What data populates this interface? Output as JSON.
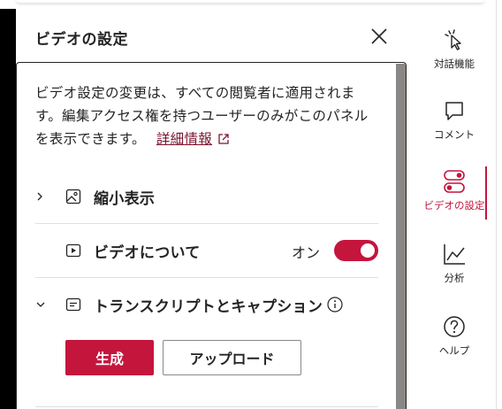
{
  "panel": {
    "title": "ビデオの設定",
    "description": "ビデオ設定の変更は、すべての閲覧者に適用されます。編集アクセス権を持つユーザーのみがこのパネルを表示できます。",
    "learn_more": "詳細情報",
    "sections": [
      {
        "label": "縮小表示",
        "icon": "image-icon",
        "expandable": true
      },
      {
        "label": "ビデオについて",
        "icon": "play-icon",
        "expandable": false,
        "toggle_text": "オン",
        "toggle_on": true
      },
      {
        "label": "トランスクリプトとキャプション",
        "icon": "caption-icon",
        "expandable": true,
        "expanded": true
      }
    ],
    "generate_button": "生成",
    "upload_button": "アップロード"
  },
  "rail": {
    "items": [
      {
        "label": "対話機能",
        "icon": "interactivity-icon"
      },
      {
        "label": "コメント",
        "icon": "comment-icon"
      },
      {
        "label": "ビデオの設定",
        "icon": "video-settings-icon",
        "active": true
      },
      {
        "label": "分析",
        "icon": "analytics-icon"
      },
      {
        "label": "ヘルプ",
        "icon": "help-icon"
      }
    ]
  },
  "colors": {
    "accent": "#c4153d",
    "link": "#7a1630",
    "text": "#242424"
  }
}
